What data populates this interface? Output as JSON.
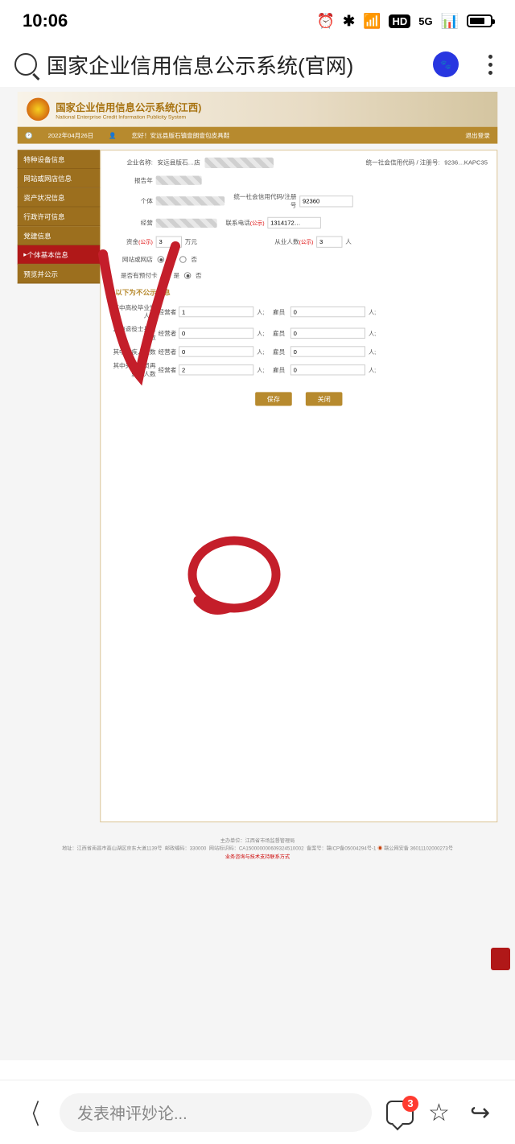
{
  "status": {
    "time": "10:06",
    "network": "5G"
  },
  "title_bar": {
    "title": "国家企业信用信息公示系统(官网)"
  },
  "site": {
    "name_cn": "国家企业信用信息公示系统",
    "name_region": "(江西)",
    "name_en": "National Enterprise Credit Information Publicity System",
    "date": "2022年04月26日",
    "greeting": "您好！安远县版石镇壹朗壹包皮具鞋",
    "logout": "退出登录"
  },
  "sidebar": {
    "items": [
      {
        "label": "特种设备信息"
      },
      {
        "label": "网站或网店信息"
      },
      {
        "label": "资产状况信息"
      },
      {
        "label": "行政许可信息"
      },
      {
        "label": "党建信息"
      },
      {
        "label": "个体基本信息"
      },
      {
        "label": "预览并公示"
      }
    ]
  },
  "form": {
    "enterprise_label": "企业名称:",
    "enterprise_value": "安远县版石…店",
    "credit_label": "统一社会信用代码 / 注册号:",
    "credit_value": "9236…KAPC35",
    "report_year_label": "报告年",
    "individual_label": "个体",
    "credit2_label": "统一社会信用代码/注册号",
    "credit2_value": "92360",
    "operator_label": "经营",
    "contact_label": "联系电话",
    "gongshi": "(公示)",
    "contact_value": "1314172…",
    "capital_label": "资金",
    "capital_unit": "万元",
    "employee_label": "从业人数",
    "employee_value": "3",
    "employee_unit": "人",
    "has_website_label": "网站或网店",
    "has_prepaid_label": "是否有预付卡",
    "yes": "是",
    "no": "否",
    "private_section": "以下为不公示信息",
    "rows": [
      {
        "label": "其中高校毕业生人数",
        "op": "经营者",
        "v1": "1",
        "emp": "雇员",
        "v2": "0"
      },
      {
        "label": "其中退役士兵人数",
        "op": "经营者",
        "v1": "0",
        "emp": "雇员",
        "v2": "0"
      },
      {
        "label": "其中残疾人人数",
        "op": "经营者",
        "v1": "0",
        "emp": "雇员",
        "v2": "0"
      },
      {
        "label": "其中失业人员再就业人数",
        "op": "经营者",
        "v1": "2",
        "emp": "雇员",
        "v2": "0"
      }
    ],
    "unit_person": "人;",
    "btn_save": "保存",
    "btn_close": "关闭"
  },
  "footer": {
    "host": "主办单位：江西省市场监督管理局",
    "addr": "地址：江西省南昌市高山湖区京东大道1139号",
    "post": "邮政编码：330000",
    "site_id": "网站标识码：CA150000000609324510002",
    "record": "备案号：赣ICP备05004294号-1",
    "police": "赣公网安备 36011102000273号",
    "support": "业务咨询与技术支持联系方式"
  },
  "bottom": {
    "comment_placeholder": "发表神评妙论...",
    "comment_count": "3"
  }
}
